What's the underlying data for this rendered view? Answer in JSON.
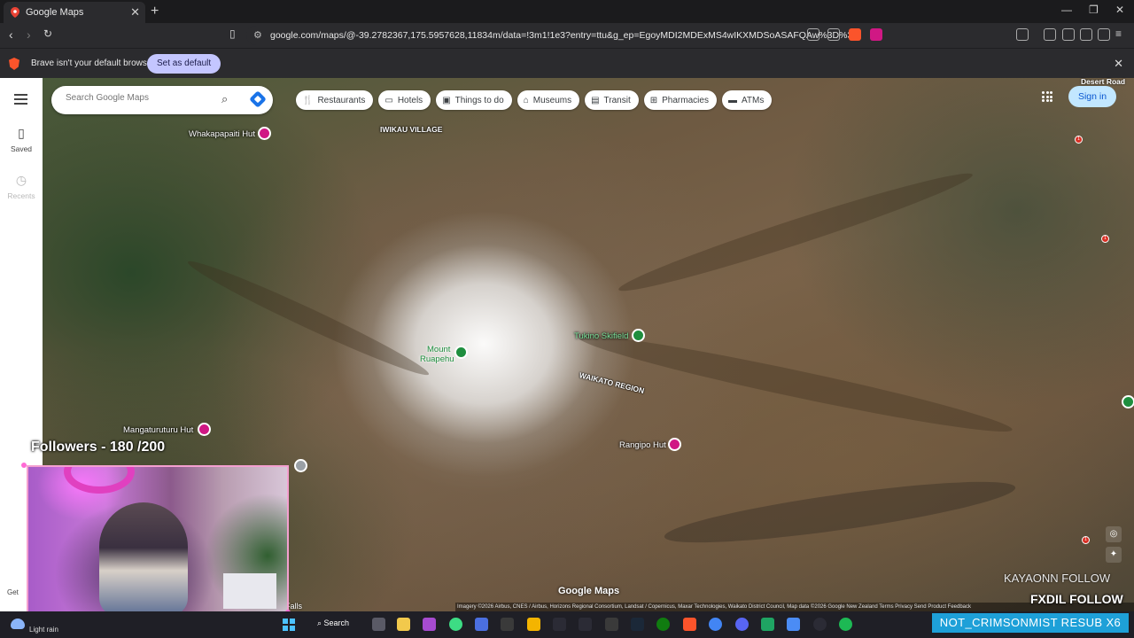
{
  "browser": {
    "tab_title": "Google Maps",
    "tab_close": "✕",
    "new_tab": "+",
    "url": "google.com/maps/@-39.2782367,175.5957628,11834m/data=!3m1!1e3?entry=ttu&g_ep=EgoyMDI2MDExMS4wIKXMDSoASAFQAw%3D%3D",
    "infobar_message": "Brave isn't your default browser",
    "set_default_label": "Set as default",
    "win_minimize": "—",
    "win_restore": "❐",
    "win_close": "✕"
  },
  "sidebar": {
    "saved_label": "Saved",
    "recents_label": "Recents",
    "get_label": "Get"
  },
  "search": {
    "placeholder": "Search Google Maps"
  },
  "chips": {
    "restaurants": "Restaurants",
    "hotels": "Hotels",
    "things_to_do": "Things to do",
    "museums": "Museums",
    "transit": "Transit",
    "pharmacies": "Pharmacies",
    "atms": "ATMs"
  },
  "header": {
    "sign_in": "Sign in",
    "desert_road": "Desert Road"
  },
  "map": {
    "iwikau_village": "IWIKAU VILLAGE",
    "whakapapaiti_hut": "Whakapapaiti Hut",
    "tukino_skifield": "Tukino Skifield",
    "mount_ruapehu_line1": "Mount",
    "mount_ruapehu_line2": "Ruapehu",
    "waikato_region": "WAIKATO REGION",
    "mangaturuturu_hut": "Mangaturuturu Hut",
    "rangipo_hut": "Rangipo Hut",
    "falls": "Falls",
    "logo": "Google Maps",
    "credits": "Imagery ©2026 Airbus, CNES / Airbus, Horizons Regional Consortium, Landsat / Copernicus, Maxar Technologies, Waikato District Council, Map data ©2026 Google    New Zealand    Terms    Privacy    Send Product Feedback",
    "road_shield": "1"
  },
  "overlay": {
    "followers": "Followers - 180 /200",
    "kaya": "KAYAONN  FOLLOW",
    "fxdil": "FXDIL  FOLLOW",
    "crimson": "NOT_CRIMSONMIST  RESUB X6"
  },
  "taskbar": {
    "weather": "Light rain",
    "search_label": "Search"
  },
  "colors": {
    "accent_blue": "#1a73e8",
    "signin_bg": "#c2e7ff",
    "pin_pink": "#d01884",
    "pin_green": "#1e8e3e",
    "brave_orange": "#fb542b",
    "overlay_blue": "#1ea0d8"
  },
  "icons": [
    "google-maps-favicon",
    "back-icon",
    "forward-icon",
    "reload-icon",
    "bookmark-icon",
    "site-info-icon",
    "brave-shield-icon",
    "menu-icon",
    "saved-icon",
    "recents-icon",
    "search-icon",
    "directions-icon",
    "restaurant-icon",
    "hotel-icon",
    "things-to-do-icon",
    "museum-icon",
    "transit-icon",
    "pharmacy-icon",
    "atm-icon",
    "apps-grid-icon",
    "my-location-icon",
    "compass-icon",
    "windows-start-icon"
  ]
}
